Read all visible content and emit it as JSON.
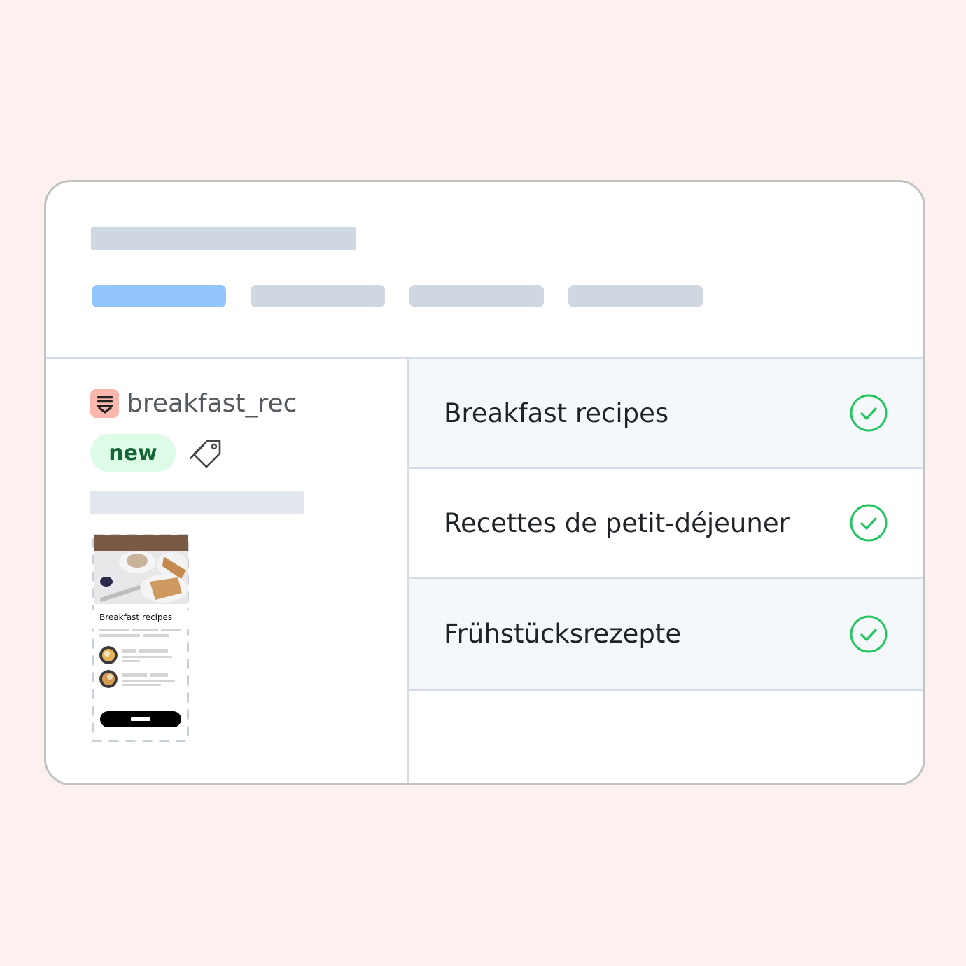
{
  "file": {
    "name": "breakfast_rec",
    "icon": "document-download-icon",
    "badge": "new",
    "tag_icon": "tag-icon"
  },
  "preview": {
    "title": "Breakfast recipes"
  },
  "translations": [
    {
      "text": "Breakfast recipes",
      "status": "check-circle-icon"
    },
    {
      "text": "Recettes de petit-déjeuner",
      "status": "check-circle-icon"
    },
    {
      "text": "Frühstücksrezepte",
      "status": "check-circle-icon"
    }
  ],
  "colors": {
    "background": "#fcf1ef",
    "active_tab": "#93c5fd",
    "badge_bg": "#dcfce7",
    "badge_text": "#166534",
    "check": "#22c55e",
    "file_icon_bg": "#fbb7ae"
  }
}
